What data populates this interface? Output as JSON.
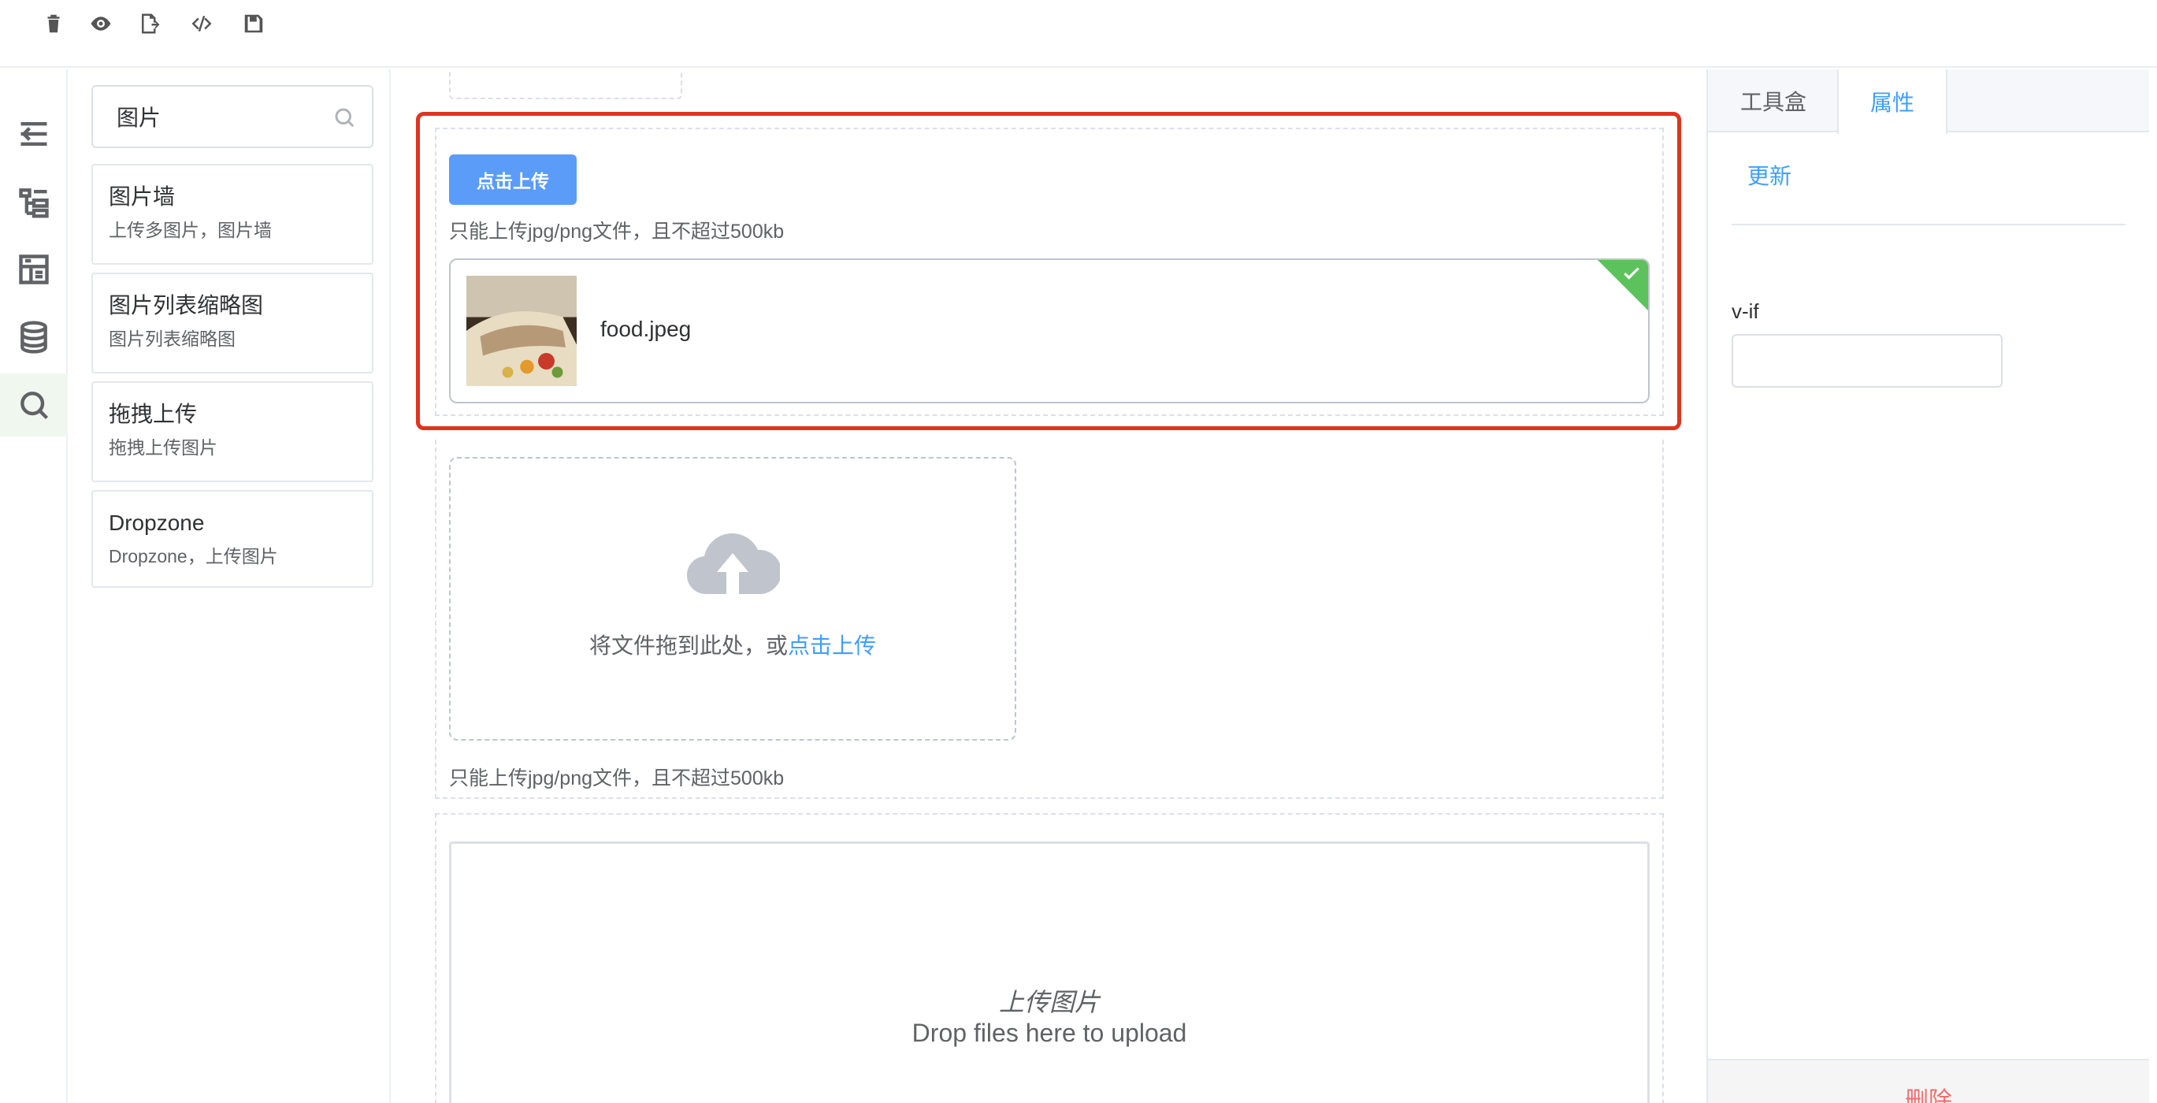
{
  "toolbar": {
    "icons": [
      "trash-icon",
      "eye-icon",
      "file-export-icon",
      "code-icon",
      "save-icon"
    ]
  },
  "leftnav": {
    "icons": [
      "collapse-icon",
      "tree-icon",
      "grid-icon",
      "database-icon",
      "search-icon"
    ],
    "active": "search-icon"
  },
  "palette": {
    "search": {
      "value": "图片",
      "placeholder": ""
    },
    "items": [
      {
        "title": "图片墙",
        "desc": "上传多图片，图片墙"
      },
      {
        "title": "图片列表缩略图",
        "desc": "图片列表缩略图"
      },
      {
        "title": "拖拽上传",
        "desc": "拖拽上传图片"
      },
      {
        "title": "Dropzone",
        "desc": "Dropzone，上传图片"
      }
    ]
  },
  "canvas": {
    "upload1": {
      "button_label": "点击上传",
      "hint": "只能上传jpg/png文件，且不超过500kb",
      "file_name": "food.jpeg"
    },
    "upload2": {
      "drag_text": "将文件拖到此处，或",
      "drag_link": "点击上传",
      "hint": "只能上传jpg/png文件，且不超过500kb"
    },
    "dropzone": {
      "title": "上传图片",
      "subtitle": "Drop files here to upload"
    }
  },
  "rightpanel": {
    "tabs": [
      "工具盒",
      "属性"
    ],
    "active_tab": "属性",
    "update_label": "更新",
    "vif_label": "v-if",
    "vif_value": "",
    "delete_label": "删除"
  },
  "colors": {
    "accent": "#409eff",
    "button": "#5a9cf8",
    "selection": "#e0341f",
    "success": "#5cc25c",
    "danger": "#f56c6c"
  }
}
